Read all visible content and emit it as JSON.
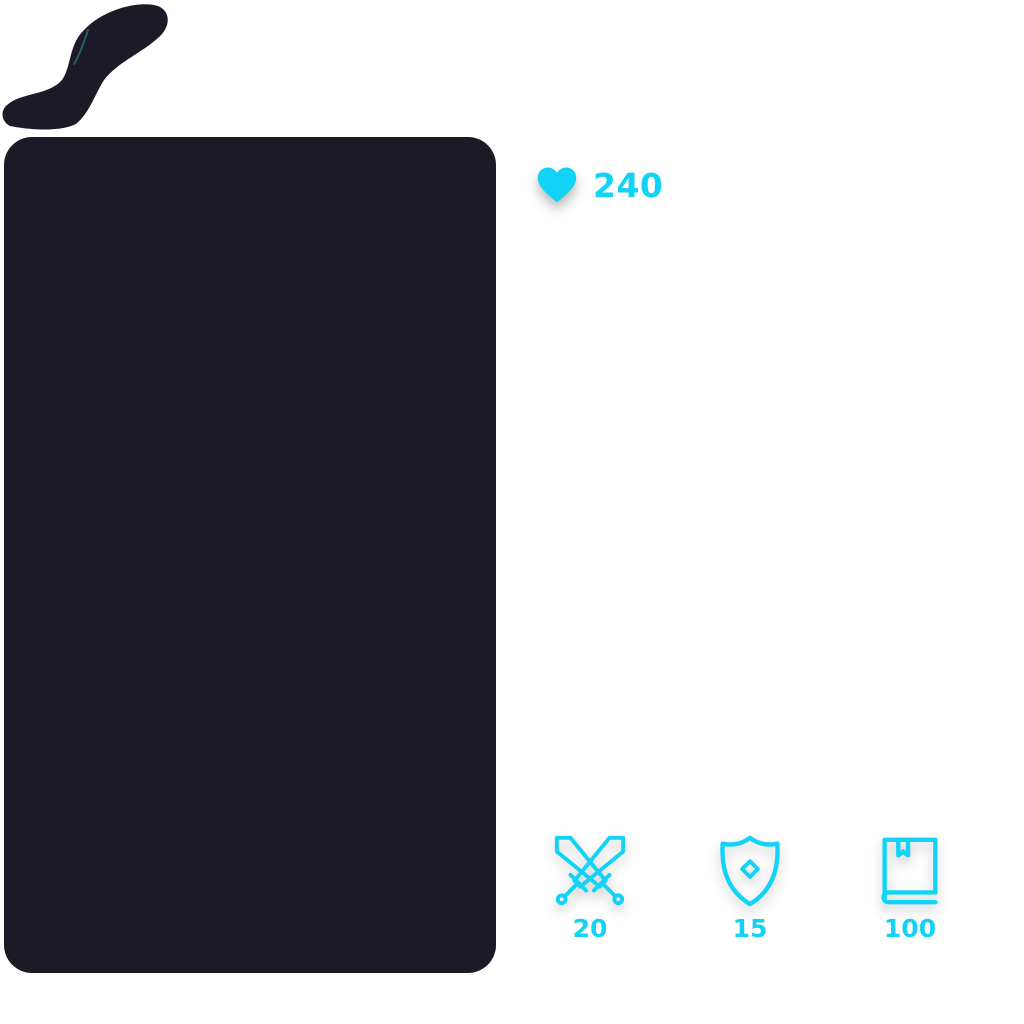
{
  "accent_color": "#12d3f5",
  "panel_color": "#1c1a26",
  "character_card": {
    "portrait": "dark-card-panel",
    "decoration": "brush-stroke-icon"
  },
  "stats": {
    "health": {
      "icon": "heart-icon",
      "value": "240"
    },
    "attack": {
      "icon": "crossed-swords-icon",
      "value": "20"
    },
    "defense": {
      "icon": "shield-icon",
      "value": "15"
    },
    "knowledge": {
      "icon": "book-icon",
      "value": "100"
    }
  }
}
